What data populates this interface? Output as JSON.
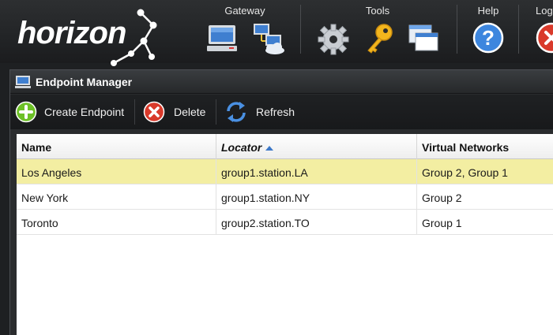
{
  "app": {
    "logo_text": "horizon"
  },
  "header": {
    "groups": [
      {
        "label": "Gateway"
      },
      {
        "label": "Tools"
      },
      {
        "label": "Help"
      },
      {
        "label": "Log"
      }
    ]
  },
  "panel": {
    "title": "Endpoint Manager"
  },
  "toolbar": {
    "create_label": "Create Endpoint",
    "delete_label": "Delete",
    "refresh_label": "Refresh"
  },
  "grid": {
    "columns": [
      {
        "label": "Name"
      },
      {
        "label": "Locator",
        "sorted": "ascending"
      },
      {
        "label": "Virtual Networks"
      }
    ],
    "rows": [
      {
        "name": "Los Angeles",
        "locator": "group1.station.LA",
        "networks": "Group 2, Group 1",
        "selected": true
      },
      {
        "name": "New York",
        "locator": "group1.station.NY",
        "networks": "Group 2",
        "selected": false
      },
      {
        "name": "Toronto",
        "locator": "group2.station.TO",
        "networks": "Group 1",
        "selected": false
      }
    ]
  },
  "colors": {
    "header_bg": "#222426",
    "selected_row": "#f3eea2",
    "sort_arrow": "#3c78c8",
    "add_green": "#6cc026",
    "delete_red": "#d93a2b"
  },
  "icons": [
    "monitor-icon",
    "network-icon",
    "gear-icon",
    "key-icon",
    "windows-icon",
    "help-icon",
    "logout-icon",
    "add-icon",
    "delete-icon",
    "refresh-icon"
  ]
}
